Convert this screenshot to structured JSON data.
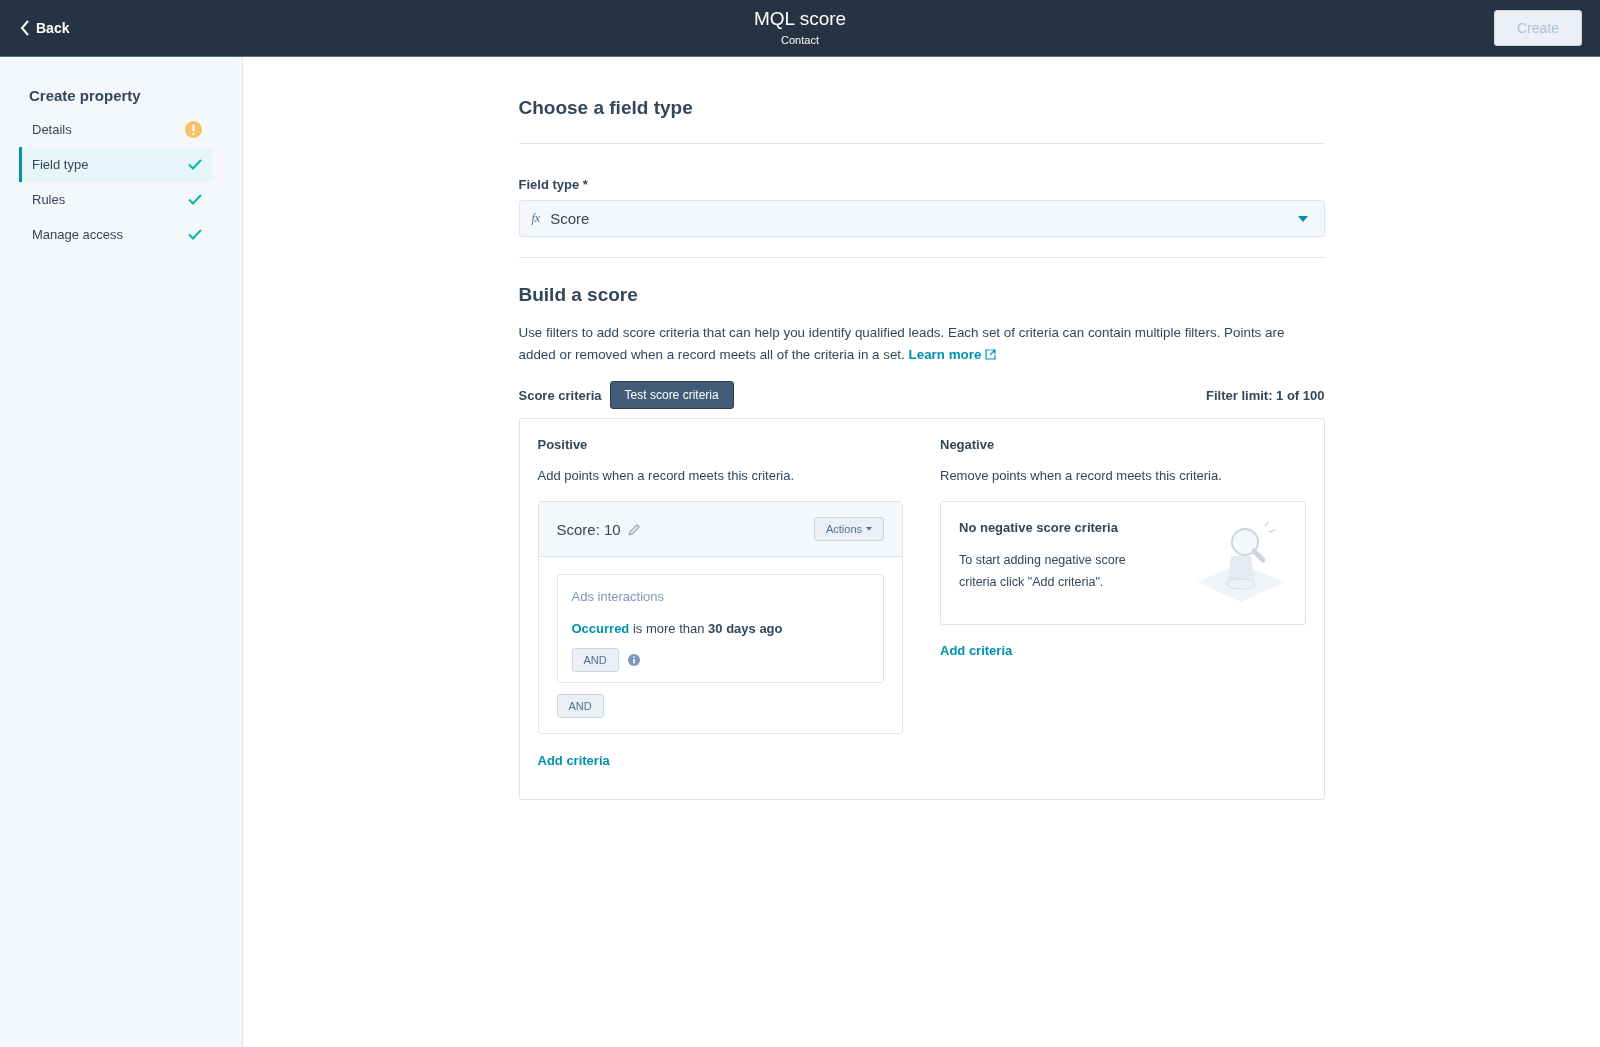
{
  "header": {
    "back": "Back",
    "title": "MQL score",
    "subtitle": "Contact",
    "create_button": {
      "label": "Create",
      "disabled": true
    }
  },
  "sidebar": {
    "title": "Create property",
    "items": [
      {
        "label": "Details",
        "complete": false,
        "selected": false
      },
      {
        "label": "Field type",
        "complete": true,
        "selected": true
      },
      {
        "label": "Rules",
        "complete": true,
        "selected": false
      },
      {
        "label": "Manage access",
        "complete": true,
        "selected": false
      }
    ]
  },
  "field_type_section": {
    "heading": "Choose a field type",
    "field_label": "Field type *",
    "value_icon": "fx",
    "value": "Score"
  },
  "build_section": {
    "heading": "Build a score",
    "description": "Use filters to add score criteria that can help you identify qualified leads. Each set of criteria can contain multiple filters. Points are added or removed when a record meets all of the criteria in a set.",
    "learn_more": "Learn more",
    "criteria_label": "Score criteria",
    "test_button": "Test score criteria",
    "filter_limit": "Filter limit: 1 of 100"
  },
  "positive": {
    "heading": "Positive",
    "description": "Add points when a record meets this criteria.",
    "groups": [
      {
        "score": "Score: 10",
        "actions": "Actions",
        "filters": [
          {
            "property": "Ads interactions",
            "field": "Occurred",
            "operator": "is more than",
            "value": "30 days ago",
            "and_button": "AND"
          }
        ],
        "and_button": "AND"
      }
    ],
    "add_link": "Add criteria"
  },
  "negative": {
    "heading": "Negative",
    "description": "Remove points when a record meets this criteria.",
    "empty": {
      "title": "No negative score criteria",
      "text": "To start adding negative score criteria click \"Add criteria\"."
    },
    "add_link": "Add criteria"
  }
}
